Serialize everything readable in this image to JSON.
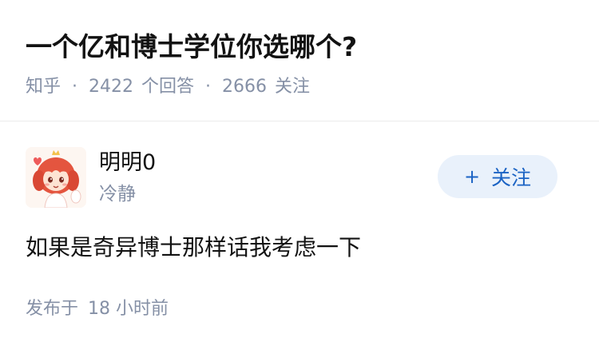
{
  "question": {
    "title": "一个亿和博士学位你选哪个?",
    "site": "知乎",
    "answer_count": "2422",
    "answer_label": "个回答",
    "follower_count": "2666",
    "follower_label": "关注",
    "separator": "·"
  },
  "answer": {
    "author": {
      "name": "明明0",
      "bio": "冷静",
      "avatar_icon": "anime-girl-avatar"
    },
    "follow_button": {
      "icon": "+",
      "label": "关注"
    },
    "content": "如果是奇异博士那样话我考虑一下",
    "published_label": "发布于",
    "published_time": "18 小时前"
  },
  "colors": {
    "text": "#121212",
    "meta": "#8590a6",
    "follow_bg": "#e9f1fb",
    "follow_text": "#1b63c4"
  }
}
